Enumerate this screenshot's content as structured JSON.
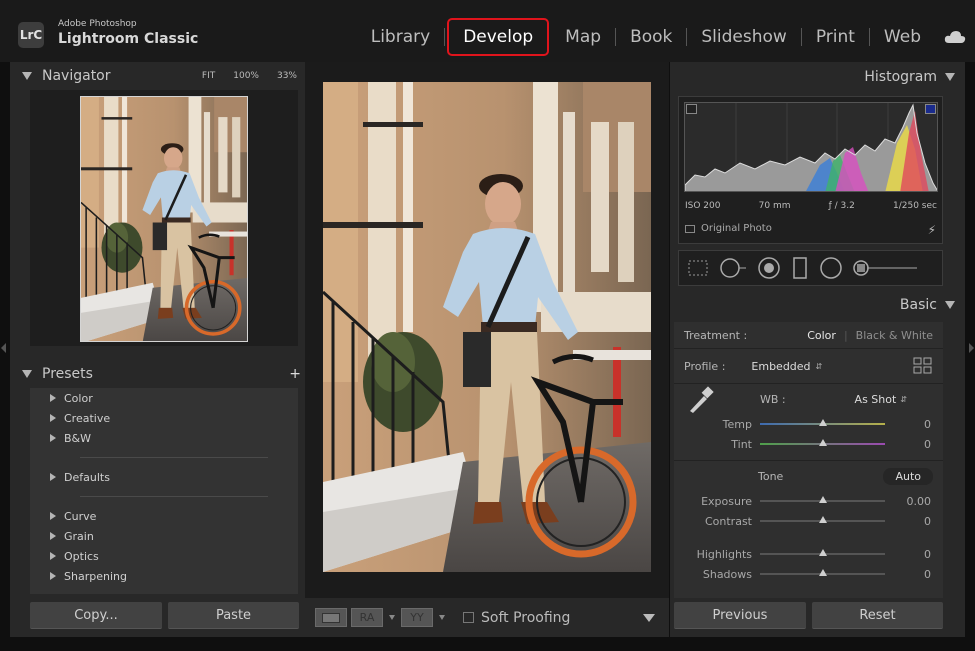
{
  "app": {
    "sub_title": "Adobe Photoshop",
    "title": "Lightroom Classic",
    "logo_text": "LrC"
  },
  "modules": [
    {
      "label": "Library"
    },
    {
      "label": "Develop",
      "active": true
    },
    {
      "label": "Map"
    },
    {
      "label": "Book"
    },
    {
      "label": "Slideshow"
    },
    {
      "label": "Print"
    },
    {
      "label": "Web"
    }
  ],
  "cloud_icon": "cloud-icon",
  "navigator": {
    "title": "Navigator",
    "zoom": [
      "FIT",
      "100%",
      "33%"
    ]
  },
  "presets": {
    "title": "Presets",
    "add_icon": "plus-icon",
    "groups": [
      [
        "Color",
        "Creative",
        "B&W"
      ],
      [
        "Defaults"
      ],
      [
        "Curve",
        "Grain",
        "Optics",
        "Sharpening"
      ]
    ]
  },
  "left_buttons": {
    "copy": "Copy...",
    "paste": "Paste"
  },
  "toolbar": {
    "view_a": "RA",
    "view_b": "YY",
    "soft_proofing": "Soft Proofing"
  },
  "histogram": {
    "title": "Histogram",
    "iso": "ISO 200",
    "focal": "70 mm",
    "aperture": "ƒ / 3.2",
    "shutter": "1/250 sec",
    "original_photo": "Original Photo"
  },
  "basic": {
    "title": "Basic",
    "treatment_label": "Treatment :",
    "treatment_color": "Color",
    "treatment_bw": "Black & White",
    "profile_label": "Profile :",
    "profile_value": "Embedded",
    "wb_label": "WB :",
    "wb_value": "As Shot",
    "temp": {
      "label": "Temp",
      "value": "0",
      "pos": 0.5
    },
    "tint": {
      "label": "Tint",
      "value": "0",
      "pos": 0.5
    },
    "tone_label": "Tone",
    "auto_label": "Auto",
    "exposure": {
      "label": "Exposure",
      "value": "0.00",
      "pos": 0.5
    },
    "contrast": {
      "label": "Contrast",
      "value": "0",
      "pos": 0.5
    },
    "highlights": {
      "label": "Highlights",
      "value": "0",
      "pos": 0.5
    },
    "shadows": {
      "label": "Shadows",
      "value": "0",
      "pos": 0.5
    }
  },
  "right_buttons": {
    "previous": "Previous",
    "reset": "Reset"
  }
}
